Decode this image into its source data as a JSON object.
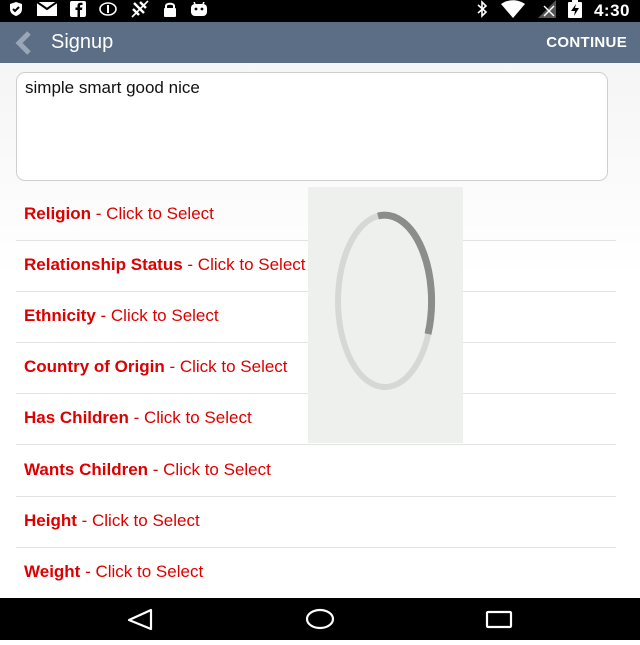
{
  "status_bar": {
    "time": "4:30",
    "icons": [
      "shield-icon",
      "mail-icon",
      "facebook-icon",
      "nfc-icon",
      "no-location-icon",
      "lock-icon",
      "android-icon",
      "bluetooth-icon",
      "wifi-icon",
      "signal-icon",
      "battery-charging-icon"
    ]
  },
  "action_bar": {
    "title": "Signup",
    "continue_label": "CONTINUE"
  },
  "description": {
    "value": "simple smart good nice"
  },
  "select_rows": [
    {
      "label": "Religion",
      "suffix": " - Click to Select"
    },
    {
      "label": "Relationship Status",
      "suffix": " - Click to Select"
    },
    {
      "label": "Ethnicity",
      "suffix": " - Click to Select"
    },
    {
      "label": "Country of Origin",
      "suffix": " - Click to Select"
    },
    {
      "label": "Has Children",
      "suffix": " - Click to Select"
    },
    {
      "label": "Wants Children",
      "suffix": " - Click to Select"
    },
    {
      "label": "Height",
      "suffix": " - Click to Select"
    },
    {
      "label": "Weight",
      "suffix": " - Click to Select"
    }
  ],
  "nav_bar": {
    "icons": [
      "back-triangle-icon",
      "home-circle-icon",
      "recents-square-icon"
    ]
  },
  "colors": {
    "action_bar": "#5c6e85",
    "row_text": "#dd0000",
    "status_bar": "#000000"
  }
}
